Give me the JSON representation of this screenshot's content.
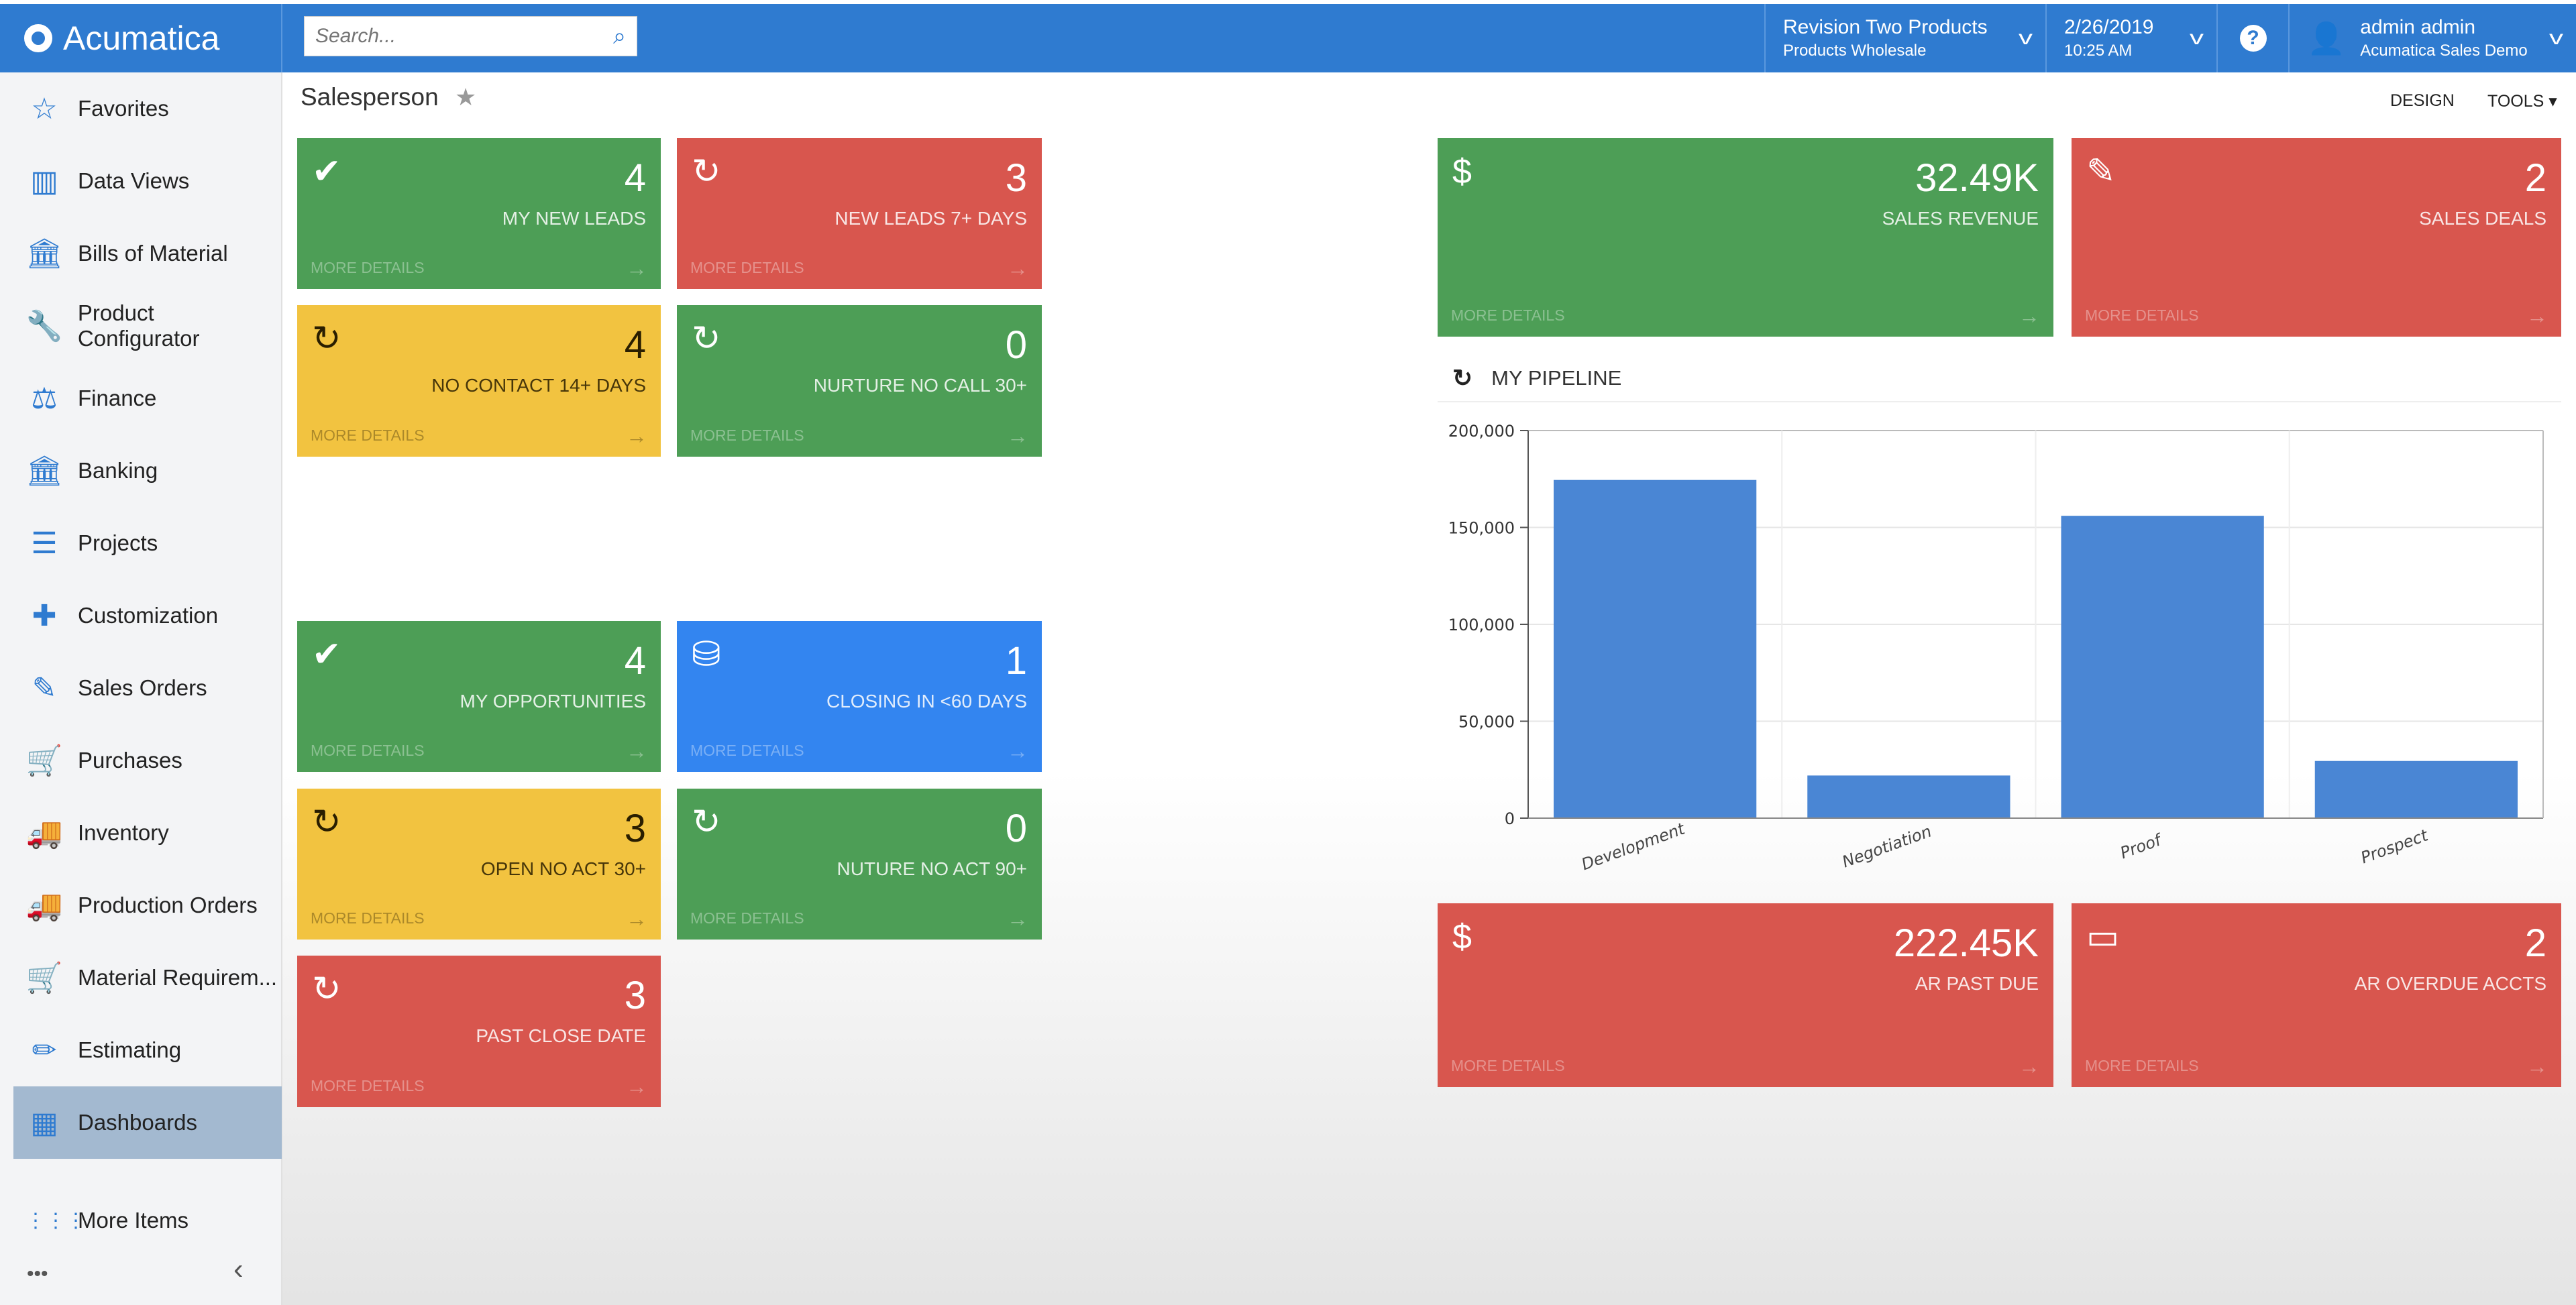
{
  "app": {
    "logo": "Acumatica",
    "search_placeholder": "Search..."
  },
  "header": {
    "company": "Revision Two Products",
    "branch": "Products Wholesale",
    "date": "2/26/2019",
    "time": "10:25 AM",
    "help": "?",
    "user": "admin admin",
    "tenant": "Acumatica Sales Demo"
  },
  "sidebar": {
    "items": [
      {
        "label": "Favorites",
        "icon": "star-icon",
        "glyph": "☆"
      },
      {
        "label": "Data Views",
        "icon": "bar-chart-icon",
        "glyph": "▥"
      },
      {
        "label": "Bills of Material",
        "icon": "bank-icon",
        "glyph": "🏛"
      },
      {
        "label": "Product Configurator",
        "icon": "wrench-icon",
        "glyph": "🔧"
      },
      {
        "label": "Finance",
        "icon": "scales-icon",
        "glyph": "⚖"
      },
      {
        "label": "Banking",
        "icon": "bank-icon",
        "glyph": "🏛"
      },
      {
        "label": "Projects",
        "icon": "projects-icon",
        "glyph": "☰"
      },
      {
        "label": "Customization",
        "icon": "puzzle-icon",
        "glyph": "✚"
      },
      {
        "label": "Sales Orders",
        "icon": "edit-icon",
        "glyph": "✎"
      },
      {
        "label": "Purchases",
        "icon": "cart-icon",
        "glyph": "🛒"
      },
      {
        "label": "Inventory",
        "icon": "truck-icon",
        "glyph": "🚚"
      },
      {
        "label": "Production Orders",
        "icon": "truck-icon",
        "glyph": "🚚"
      },
      {
        "label": "Material Requirem...",
        "icon": "cart-plus-icon",
        "glyph": "🛒"
      },
      {
        "label": "Estimating",
        "icon": "pencil-icon",
        "glyph": "✏"
      },
      {
        "label": "Dashboards",
        "icon": "dashboard-icon",
        "glyph": "▦",
        "active": true
      }
    ],
    "more": {
      "label": "More Items",
      "icon": "grid-icon",
      "glyph": "⋮⋮⋮"
    },
    "dots": "•••",
    "collapse": "‹"
  },
  "page": {
    "title": "Salesperson",
    "design": "DESIGN",
    "tools": "TOOLS ▾"
  },
  "colors": {
    "green": "#4d9e56",
    "red": "#d8564e",
    "yellow": "#f2c340",
    "blue": "#3385f0",
    "header": "#2f7bd0",
    "bar": "#4a86d4"
  },
  "tiles": [
    {
      "value": "4",
      "label": "MY NEW LEADS",
      "color": "green",
      "icon": "check-circle-icon",
      "glyph": "✔"
    },
    {
      "value": "3",
      "label": "NEW LEADS 7+ DAYS",
      "color": "red",
      "icon": "clock-refresh-icon",
      "glyph": "↻"
    },
    {
      "value": "4",
      "label": "NO CONTACT 14+ DAYS",
      "color": "yellow",
      "icon": "clock-refresh-icon",
      "glyph": "↻"
    },
    {
      "value": "0",
      "label": "NURTURE NO CALL 30+",
      "color": "green",
      "icon": "clock-refresh-icon",
      "glyph": "↻"
    },
    {
      "value": "4",
      "label": "MY OPPORTUNITIES",
      "color": "green",
      "icon": "check-circle-icon",
      "glyph": "✔"
    },
    {
      "value": "1",
      "label": "CLOSING IN <60 DAYS",
      "color": "blue",
      "icon": "coins-icon",
      "glyph": "⛁"
    },
    {
      "value": "3",
      "label": "OPEN NO ACT 30+",
      "color": "yellow",
      "icon": "clock-refresh-icon",
      "glyph": "↻"
    },
    {
      "value": "0",
      "label": "NUTURE NO ACT 90+",
      "color": "green",
      "icon": "clock-refresh-icon",
      "glyph": "↻"
    },
    {
      "value": "3",
      "label": "PAST CLOSE DATE",
      "color": "red",
      "icon": "clock-refresh-icon",
      "glyph": "↻"
    },
    {
      "value": "32.49K",
      "label": "SALES REVENUE",
      "color": "green",
      "icon": "dollar-icon",
      "glyph": "$"
    },
    {
      "value": "2",
      "label": "SALES DEALS",
      "color": "red",
      "icon": "edit-icon",
      "glyph": "✎"
    },
    {
      "value": "222.45K",
      "label": "AR PAST DUE",
      "color": "red",
      "icon": "dollar-icon",
      "glyph": "$"
    },
    {
      "value": "2",
      "label": "AR OVERDUE ACCTS",
      "color": "red",
      "icon": "credit-card-icon",
      "glyph": "▭"
    }
  ],
  "tile_more": "MORE DETAILS",
  "pipeline": {
    "title": "MY PIPELINE"
  },
  "chart_data": {
    "type": "bar",
    "title": "",
    "categories": [
      "Development",
      "Negotiation",
      "Proof",
      "Prospect"
    ],
    "values": [
      174500,
      22000,
      156000,
      29500
    ],
    "ylim": [
      0,
      200000
    ],
    "yticks": [
      "0",
      "50,000",
      "100,000",
      "150,000",
      "200,000"
    ],
    "grid": true,
    "xlabel": "",
    "ylabel": ""
  }
}
